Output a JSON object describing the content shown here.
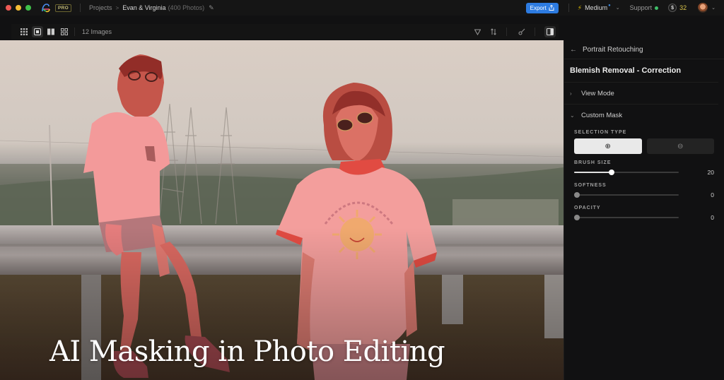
{
  "window": {
    "traffic_lights": {
      "close": "#ee5a55",
      "minimize": "#f4bd35",
      "maximize": "#3fc04a"
    },
    "logo_icon": "app-logo-icon",
    "plan_badge": "PRO"
  },
  "breadcrumb": {
    "root": "Projects",
    "separator": ">",
    "current": "Evan & Virginia",
    "count": "(400 Photos)",
    "edit_icon": "pencil-icon"
  },
  "topbar": {
    "export_label": "Export",
    "export_icon": "share-icon",
    "quality_label": "Medium",
    "quality_icon": "bolt-icon",
    "support_label": "Support",
    "support_status_color": "#3fbf6a",
    "credits_symbol": "$",
    "credits": "32",
    "accent_color": "#2d7be0"
  },
  "toolbar": {
    "view_modes": [
      "grid-view",
      "single-view",
      "compare-view",
      "multi-view"
    ],
    "active_view": "single-view",
    "image_count": "12 Images",
    "tools": [
      "filter-icon",
      "sort-icon",
      "mask-brush-icon",
      "panel-toggle-icon"
    ]
  },
  "canvas": {
    "headline": "AI Masking in Photo Editing",
    "mask_color": "#f05a5a"
  },
  "panel": {
    "back_label": "Portrait Retouching",
    "title": "Blemish Removal - Correction",
    "sections": [
      {
        "label": "View Mode",
        "expanded": false
      },
      {
        "label": "Custom Mask",
        "expanded": true
      }
    ],
    "selection_type": {
      "label": "SELECTION TYPE",
      "options": [
        {
          "name": "add",
          "icon": "⊕",
          "selected": true
        },
        {
          "name": "subtract",
          "icon": "⊖",
          "selected": false
        }
      ]
    },
    "sliders": [
      {
        "label": "BRUSH SIZE",
        "value": "20",
        "fraction": 0.36
      },
      {
        "label": "SOFTNESS",
        "value": "0",
        "fraction": 0
      },
      {
        "label": "OPACITY",
        "value": "0",
        "fraction": 0
      }
    ]
  }
}
